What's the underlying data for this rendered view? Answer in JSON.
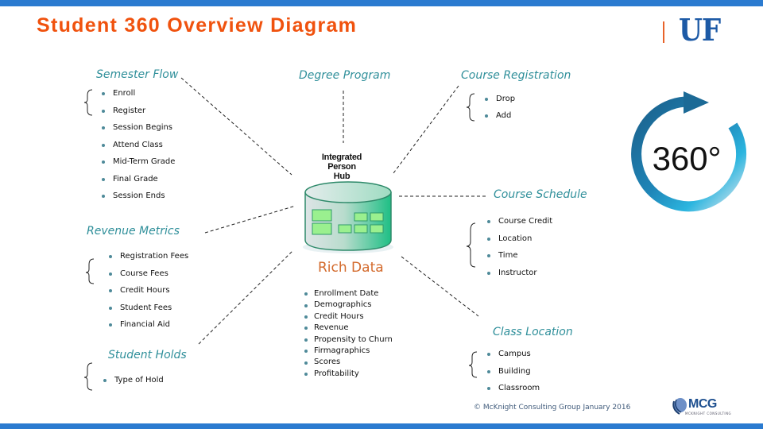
{
  "title": "Student 360 Overview Diagram",
  "logo": {
    "text": "UF"
  },
  "badge_360": {
    "text": "360°"
  },
  "hub": {
    "label_lines": [
      "Integrated",
      "Person",
      "Hub"
    ]
  },
  "sections": {
    "semester_flow": {
      "heading": "Semester Flow",
      "items": [
        "Enroll",
        "Register",
        "Session Begins",
        "Attend Class",
        "Mid-Term Grade",
        "Final Grade",
        "Session Ends"
      ]
    },
    "degree_program": {
      "heading": "Degree Program"
    },
    "course_registration": {
      "heading": "Course Registration",
      "items": [
        "Drop",
        "Add"
      ]
    },
    "course_schedule": {
      "heading": "Course Schedule",
      "items": [
        "Course Credit",
        "Location",
        "Time",
        "Instructor"
      ]
    },
    "revenue_metrics": {
      "heading": "Revenue Metrics",
      "items": [
        "Registration Fees",
        "Course Fees",
        "Credit Hours",
        "Student Fees",
        "Financial Aid"
      ]
    },
    "student_holds": {
      "heading": "Student Holds",
      "items": [
        "Type of Hold"
      ]
    },
    "rich_data": {
      "heading": "Rich Data",
      "items": [
        "Enrollment Date",
        "Demographics",
        "Credit Hours",
        "Revenue",
        "Propensity to Churn",
        "Firmagraphics",
        "Scores",
        "Profitability"
      ]
    },
    "class_location": {
      "heading": "Class Location",
      "items": [
        "Campus",
        "Building",
        "Classroom"
      ]
    }
  },
  "footer": {
    "copyright": "© McKnight Consulting Group January 2016",
    "mcg_logo": "MCG",
    "mcg_sub": "MCKNIGHT CONSULTING"
  },
  "colors": {
    "bar_blue": "#2b7bd0",
    "title_orange": "#f0520e",
    "heading_teal": "#2f8f9a",
    "uf_blue": "#1d5aa6",
    "rich_orange": "#d36a2c"
  }
}
